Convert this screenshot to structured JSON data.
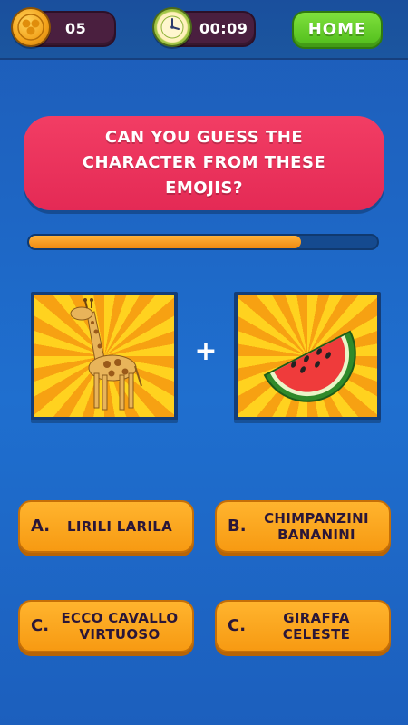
{
  "hud": {
    "coins": "05",
    "timer": "00:09",
    "home_label": "HOME"
  },
  "question": {
    "text": "CAN YOU GUESS THE CHARACTER FROM THESE EMOJIS?",
    "progress": 0.78
  },
  "emojis": [
    {
      "name": "giraffe-emoji"
    },
    {
      "name": "watermelon-emoji"
    }
  ],
  "plus_sign": "+",
  "answers": [
    {
      "letter": "A.",
      "text": "LIRILI LARILA"
    },
    {
      "letter": "B.",
      "text": "CHIMPANZINI BANANINI"
    },
    {
      "letter": "C.",
      "text": "ECCO CAVALLO VIRTUOSO"
    },
    {
      "letter": "C.",
      "text": "GIRAFFA CELESTE"
    }
  ],
  "colors": {
    "background": "#1f6fcf",
    "question_panel": "#e42a55",
    "answer_button": "#f79a12",
    "progress_fill": "#f08a10",
    "home_button": "#4fbc1a",
    "pill": "#4a1f3f"
  }
}
